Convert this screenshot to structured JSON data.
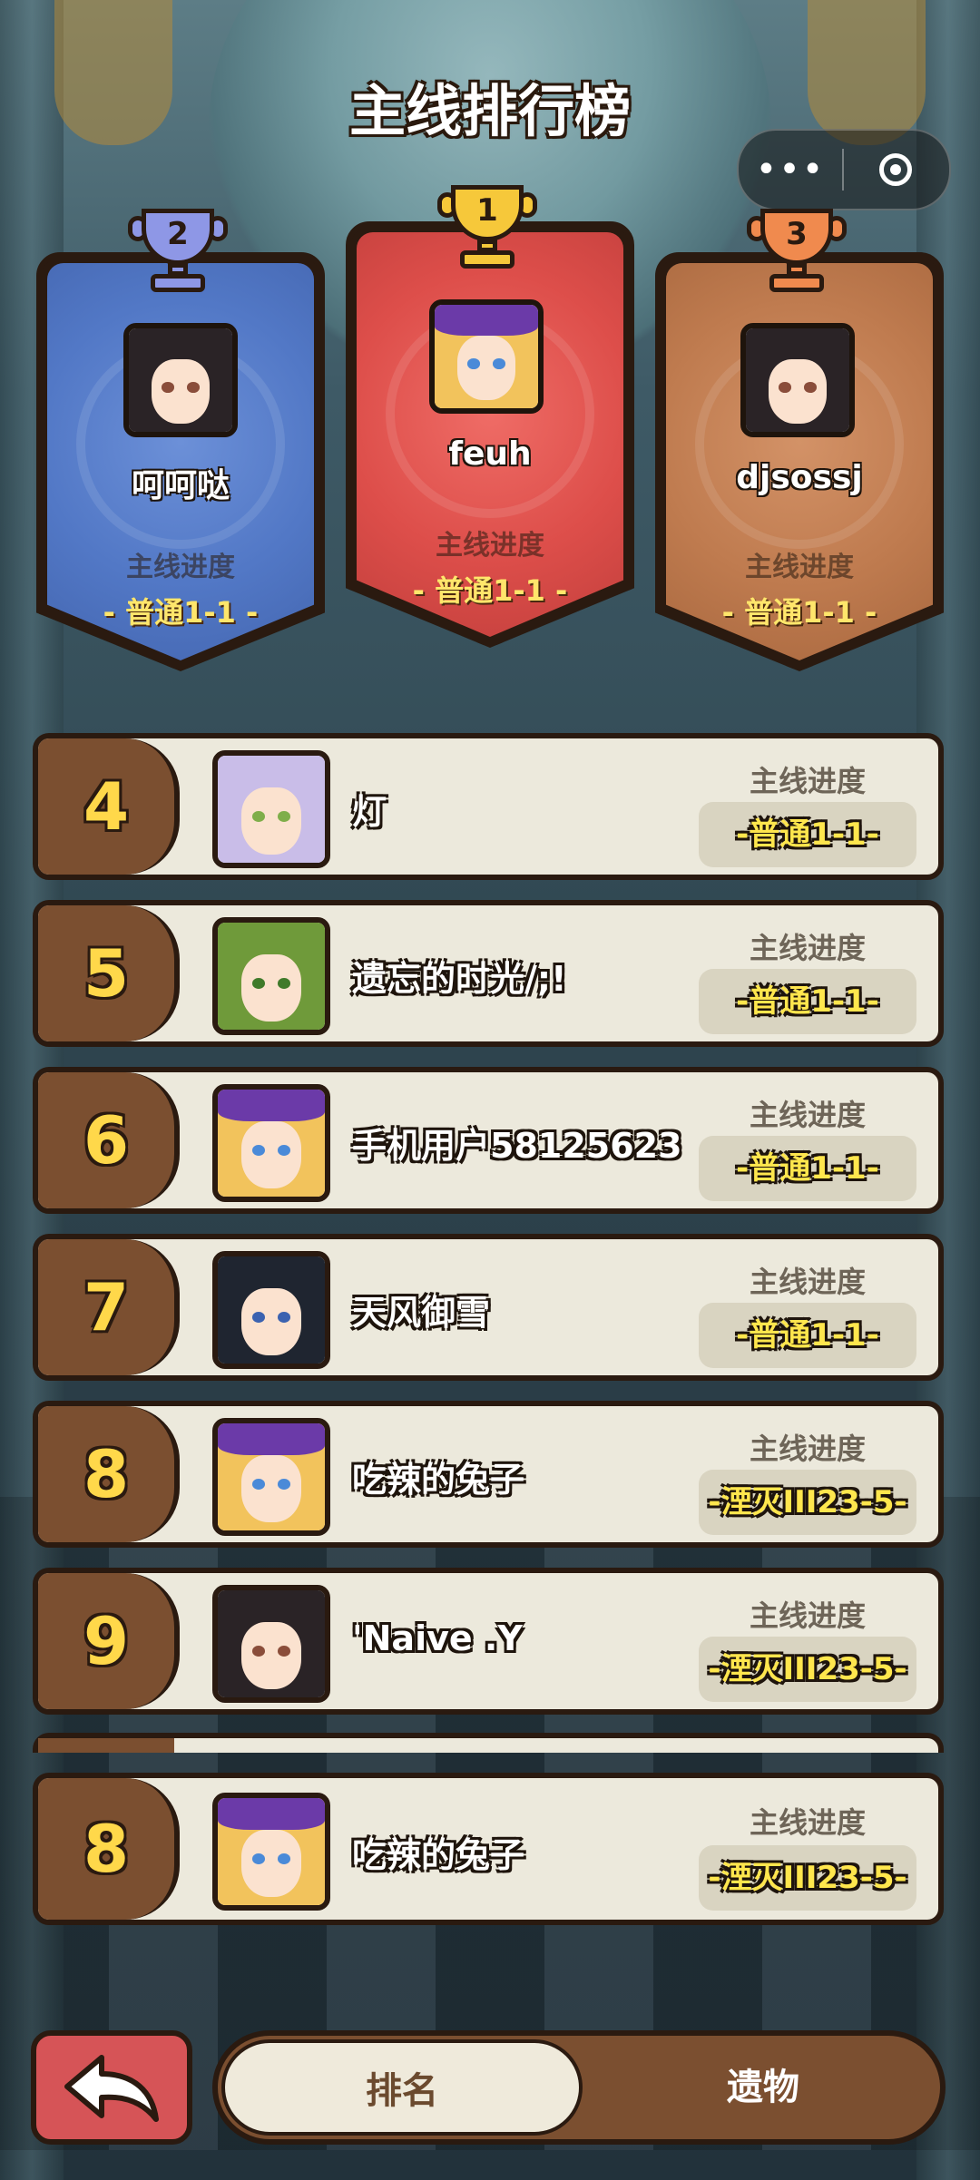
{
  "header": {
    "title": "主线排行榜"
  },
  "capsule": {
    "more": "•••",
    "more_icon": "more-dots-icon",
    "close_icon": "target-close-icon"
  },
  "podium": [
    {
      "rank": "2",
      "name": "呵呵哒",
      "label": "主线进度",
      "progress": "- 普通1-1 -",
      "color": "#5278c6"
    },
    {
      "rank": "1",
      "name": "feuh",
      "label": "主线进度",
      "progress": "- 普通1-1 -",
      "color": "#dd4e4a"
    },
    {
      "rank": "3",
      "name": "djsossj",
      "label": "主线进度",
      "progress": "- 普通1-1 -",
      "color": "#bf7b4f"
    }
  ],
  "rows": [
    {
      "rank": "4",
      "name": "灯",
      "label": "主线进度",
      "progress": "-普通1-1-"
    },
    {
      "rank": "5",
      "name": "遗忘的时光/;!",
      "label": "主线进度",
      "progress": "-普通1-1-"
    },
    {
      "rank": "6",
      "name": "手机用户58125623",
      "label": "主线进度",
      "progress": "-普通1-1-"
    },
    {
      "rank": "7",
      "name": "天风御雪",
      "label": "主线进度",
      "progress": "-普通1-1-"
    },
    {
      "rank": "8",
      "name": "吃辣的兔子",
      "label": "主线进度",
      "progress": "-湮灭III23-5-"
    },
    {
      "rank": "9",
      "name": "'Naive .Y",
      "label": "主线进度",
      "progress": "-湮灭III23-5-"
    }
  ],
  "my_rank": {
    "rank": "8",
    "name": "吃辣的兔子",
    "label": "主线进度",
    "progress": "-湮灭III23-5-"
  },
  "bottom": {
    "back_icon": "back-arrow-icon",
    "tab_ranking": "排名",
    "tab_relics": "遗物"
  }
}
